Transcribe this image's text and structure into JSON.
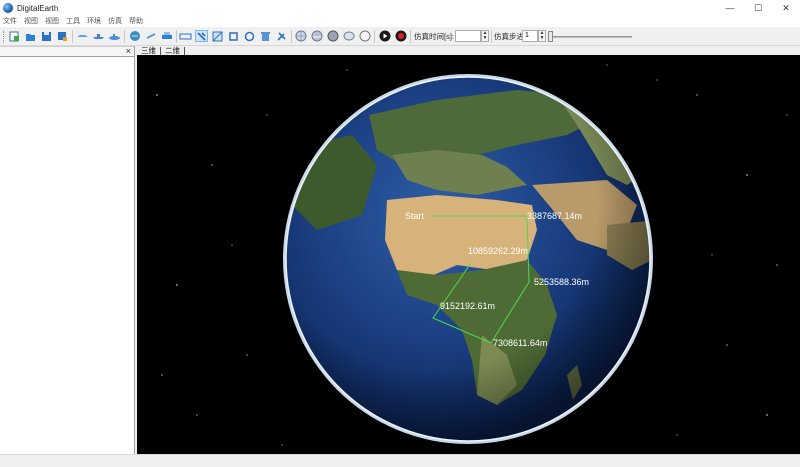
{
  "window": {
    "title": "DigitalEarth",
    "minimize_glyph": "—",
    "maximize_glyph": "☐",
    "close_glyph": "✕"
  },
  "menu": [
    "文件",
    "视图",
    "视图",
    "工具",
    "环境",
    "仿真",
    "帮助"
  ],
  "toolbar": {
    "sim_time_label": "仿真时间[s]:",
    "sim_time_value": "",
    "sim_step_label": "仿真步进:",
    "sim_step_value": "1",
    "icons": [
      "new-file-icon",
      "open-folder-icon",
      "save-icon",
      "save-as-icon",
      "aircraft-icon",
      "ship-icon",
      "submarine-icon",
      "globe-add-icon",
      "satellite-icon",
      "vehicle-icon",
      "ruler-icon",
      "pointer-icon",
      "area-measure-icon",
      "crop-icon",
      "rotate-icon",
      "delete-icon",
      "settings-tools-icon",
      "globe-grid-icon",
      "cloud-icon",
      "sphere-icon",
      "ocean-icon",
      "compass-icon",
      "play-icon",
      "record-icon"
    ]
  },
  "left_panel": {
    "close_glyph": "×"
  },
  "tabs": [
    "三维",
    "二维"
  ],
  "viewport": {
    "measurements": {
      "start": "Start",
      "seg1": "3387687.14m",
      "seg2": "10859262.29m",
      "seg3": "5253588.36m",
      "seg4": "9152192.61m",
      "seg5": "7308611.64m"
    },
    "line_color": "#4cd94c"
  }
}
